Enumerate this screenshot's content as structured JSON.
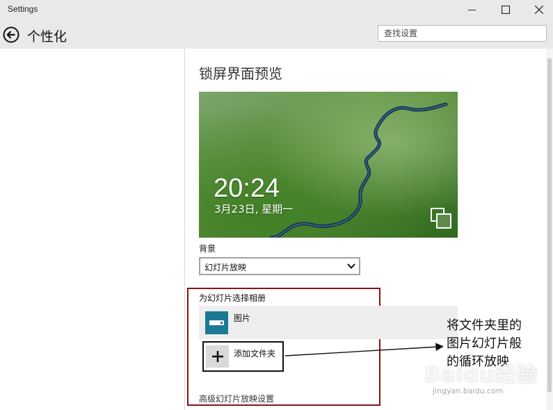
{
  "window": {
    "title": "Settings"
  },
  "header": {
    "title": "个性化",
    "search_placeholder": "查找设置"
  },
  "lockscreen": {
    "section_title": "锁屏界面预览",
    "time": "20:24",
    "date": "3月23日, 星期一",
    "background_label": "背景",
    "background_value": "幻灯片放映",
    "album_section_label": "为幻灯片选择相册",
    "albums": [
      {
        "name": "图片"
      }
    ],
    "add_folder_label": "添加文件夹",
    "advanced_link": "高级幻灯片放映设置"
  },
  "annotation": {
    "lines": [
      "将文件夹里的",
      "图片幻灯片般",
      "的循环放映"
    ]
  },
  "watermark": {
    "text": "Baidu经验",
    "sub": "jingyan.baidu.com"
  },
  "colors": {
    "accent_tile": "#1a7a96",
    "highlight_border": "#8b1111",
    "chrome_bg": "#e9e9e9"
  },
  "icons": [
    "back-arrow-icon",
    "minimize-icon",
    "maximize-icon",
    "close-icon",
    "chevron-down-icon",
    "slideshow-icon",
    "plus-icon",
    "picture-folder-icon"
  ]
}
